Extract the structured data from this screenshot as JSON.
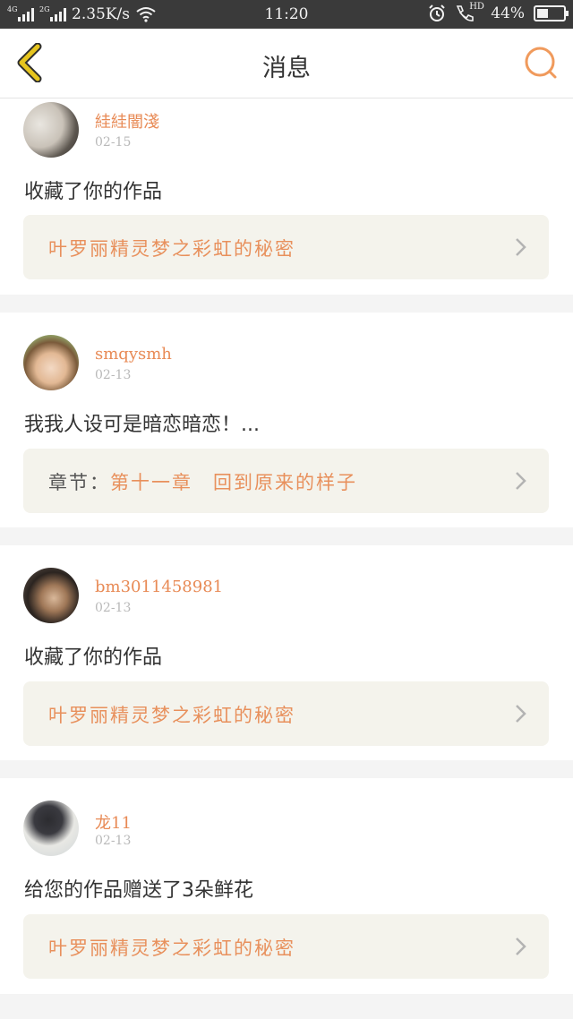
{
  "status_bar": {
    "network_1": "4G",
    "network_2": "2G",
    "speed": "2.35K/s",
    "time": "11:20",
    "hd_label": "HD",
    "battery_text": "44%",
    "battery_level": 0.44
  },
  "header": {
    "title": "消息"
  },
  "messages": [
    {
      "username": "絓絓闇淺",
      "date": "02-15",
      "text": "收藏了你的作品",
      "link_prefix": "",
      "link_text": "叶罗丽精灵梦之彩虹的秘密"
    },
    {
      "username": "smqysmh",
      "date": "02-13",
      "text": "我我人设可是暗恋暗恋！...",
      "link_prefix": "章节：",
      "link_text": "第十一章　回到原来的样子"
    },
    {
      "username": "bm3011458981",
      "date": "02-13",
      "text": "收藏了你的作品",
      "link_prefix": "",
      "link_text": "叶罗丽精灵梦之彩虹的秘密"
    },
    {
      "username": "龙11",
      "date": "02-13",
      "text": "给您的作品赠送了3朵鲜花",
      "link_prefix": "",
      "link_text": "叶罗丽精灵梦之彩虹的秘密"
    }
  ],
  "colors": {
    "accent": "#e88a55",
    "back_icon": "#e6c51f",
    "link_bg": "#f4f3ec"
  }
}
